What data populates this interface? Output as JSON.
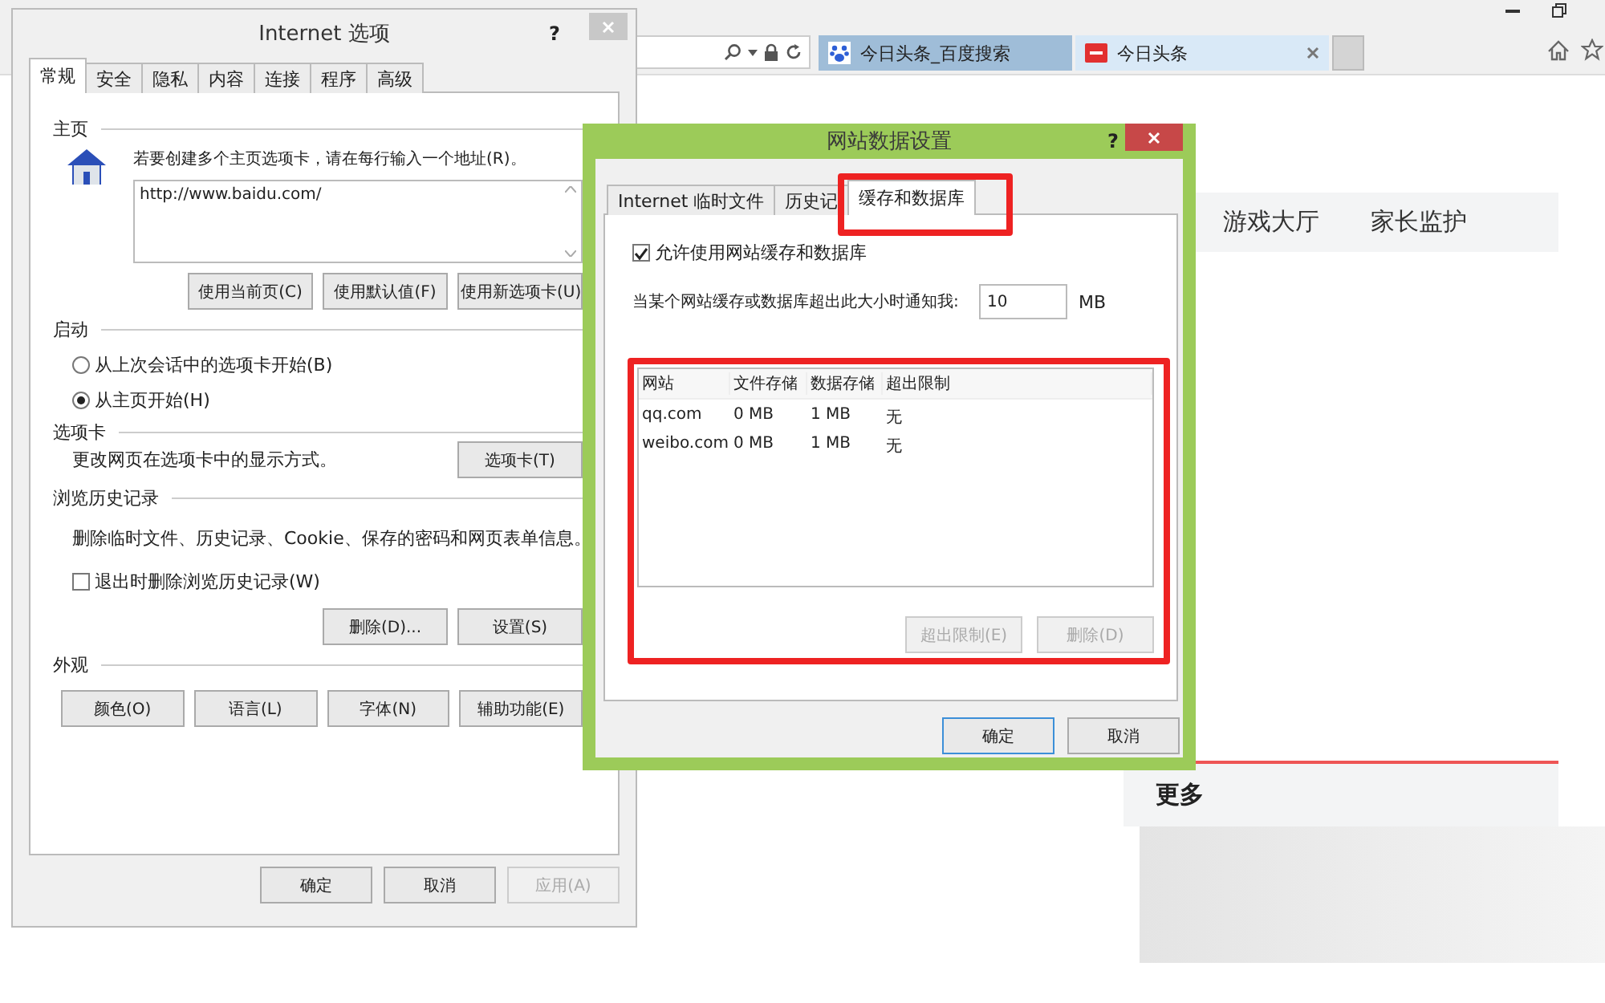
{
  "browser": {
    "tabs": [
      {
        "label": "今日头条_百度搜索",
        "selected": false,
        "closable": false
      },
      {
        "label": "今日头条",
        "selected": true,
        "closable": true
      }
    ],
    "page": {
      "nav": [
        "游戏大厅",
        "家长监护"
      ],
      "more_heading": "更多"
    }
  },
  "options_dialog": {
    "title": "Internet 选项",
    "help": "?",
    "tabs": [
      {
        "label": "常规",
        "selected": true
      },
      {
        "label": "安全",
        "selected": false
      },
      {
        "label": "隐私",
        "selected": false
      },
      {
        "label": "内容",
        "selected": false
      },
      {
        "label": "连接",
        "selected": false
      },
      {
        "label": "程序",
        "selected": false
      },
      {
        "label": "高级",
        "selected": false
      }
    ],
    "home": {
      "heading": "主页",
      "hint": "若要创建多个主页选项卡，请在每行输入一个地址(R)。",
      "value": "http://www.baidu.com/",
      "buttons": [
        "使用当前页(C)",
        "使用默认值(F)",
        "使用新选项卡(U)"
      ]
    },
    "startup": {
      "heading": "启动",
      "options": [
        {
          "label": "从上次会话中的选项卡开始(B)",
          "selected": false
        },
        {
          "label": "从主页开始(H)",
          "selected": true
        }
      ]
    },
    "tabs_section": {
      "heading": "选项卡",
      "text": "更改网页在选项卡中的显示方式。",
      "button": "选项卡(T)"
    },
    "history": {
      "heading": "浏览历史记录",
      "text": "删除临时文件、历史记录、Cookie、保存的密码和网页表单信息。",
      "checkbox": {
        "label": "退出时删除浏览历史记录(W)",
        "checked": false
      },
      "buttons": [
        "删除(D)...",
        "设置(S)"
      ]
    },
    "appearance": {
      "heading": "外观",
      "buttons": [
        "颜色(O)",
        "语言(L)",
        "字体(N)",
        "辅助功能(E)"
      ]
    },
    "footer": [
      {
        "label": "确定",
        "disabled": false
      },
      {
        "label": "取消",
        "disabled": false
      },
      {
        "label": "应用(A)",
        "disabled": true
      }
    ]
  },
  "data_dialog": {
    "title": "网站数据设置",
    "help": "?",
    "tabs": [
      {
        "label": "Internet 临时文件",
        "selected": false,
        "highlighted": false
      },
      {
        "label": "历史记",
        "selected": false,
        "highlighted": false
      },
      {
        "label": "缓存和数据库",
        "selected": true,
        "highlighted": true
      }
    ],
    "allow": {
      "label": "允许使用网站缓存和数据库",
      "checked": true
    },
    "limit": {
      "label": "当某个网站缓存或数据库超出此大小时通知我:",
      "value": "10",
      "unit": "MB"
    },
    "sites": {
      "highlighted": true,
      "columns": [
        "网站",
        "文件存储",
        "数据存储",
        "超出限制"
      ],
      "rows": [
        [
          "qq.com",
          "0 MB",
          "1 MB",
          "无"
        ],
        [
          "weibo.com",
          "0 MB",
          "1 MB",
          "无"
        ]
      ],
      "buttons": [
        {
          "label": "超出限制(E)",
          "disabled": true
        },
        {
          "label": "删除(D)",
          "disabled": true
        }
      ]
    },
    "footer": [
      {
        "label": "确定",
        "default": true
      },
      {
        "label": "取消",
        "default": false
      }
    ]
  }
}
